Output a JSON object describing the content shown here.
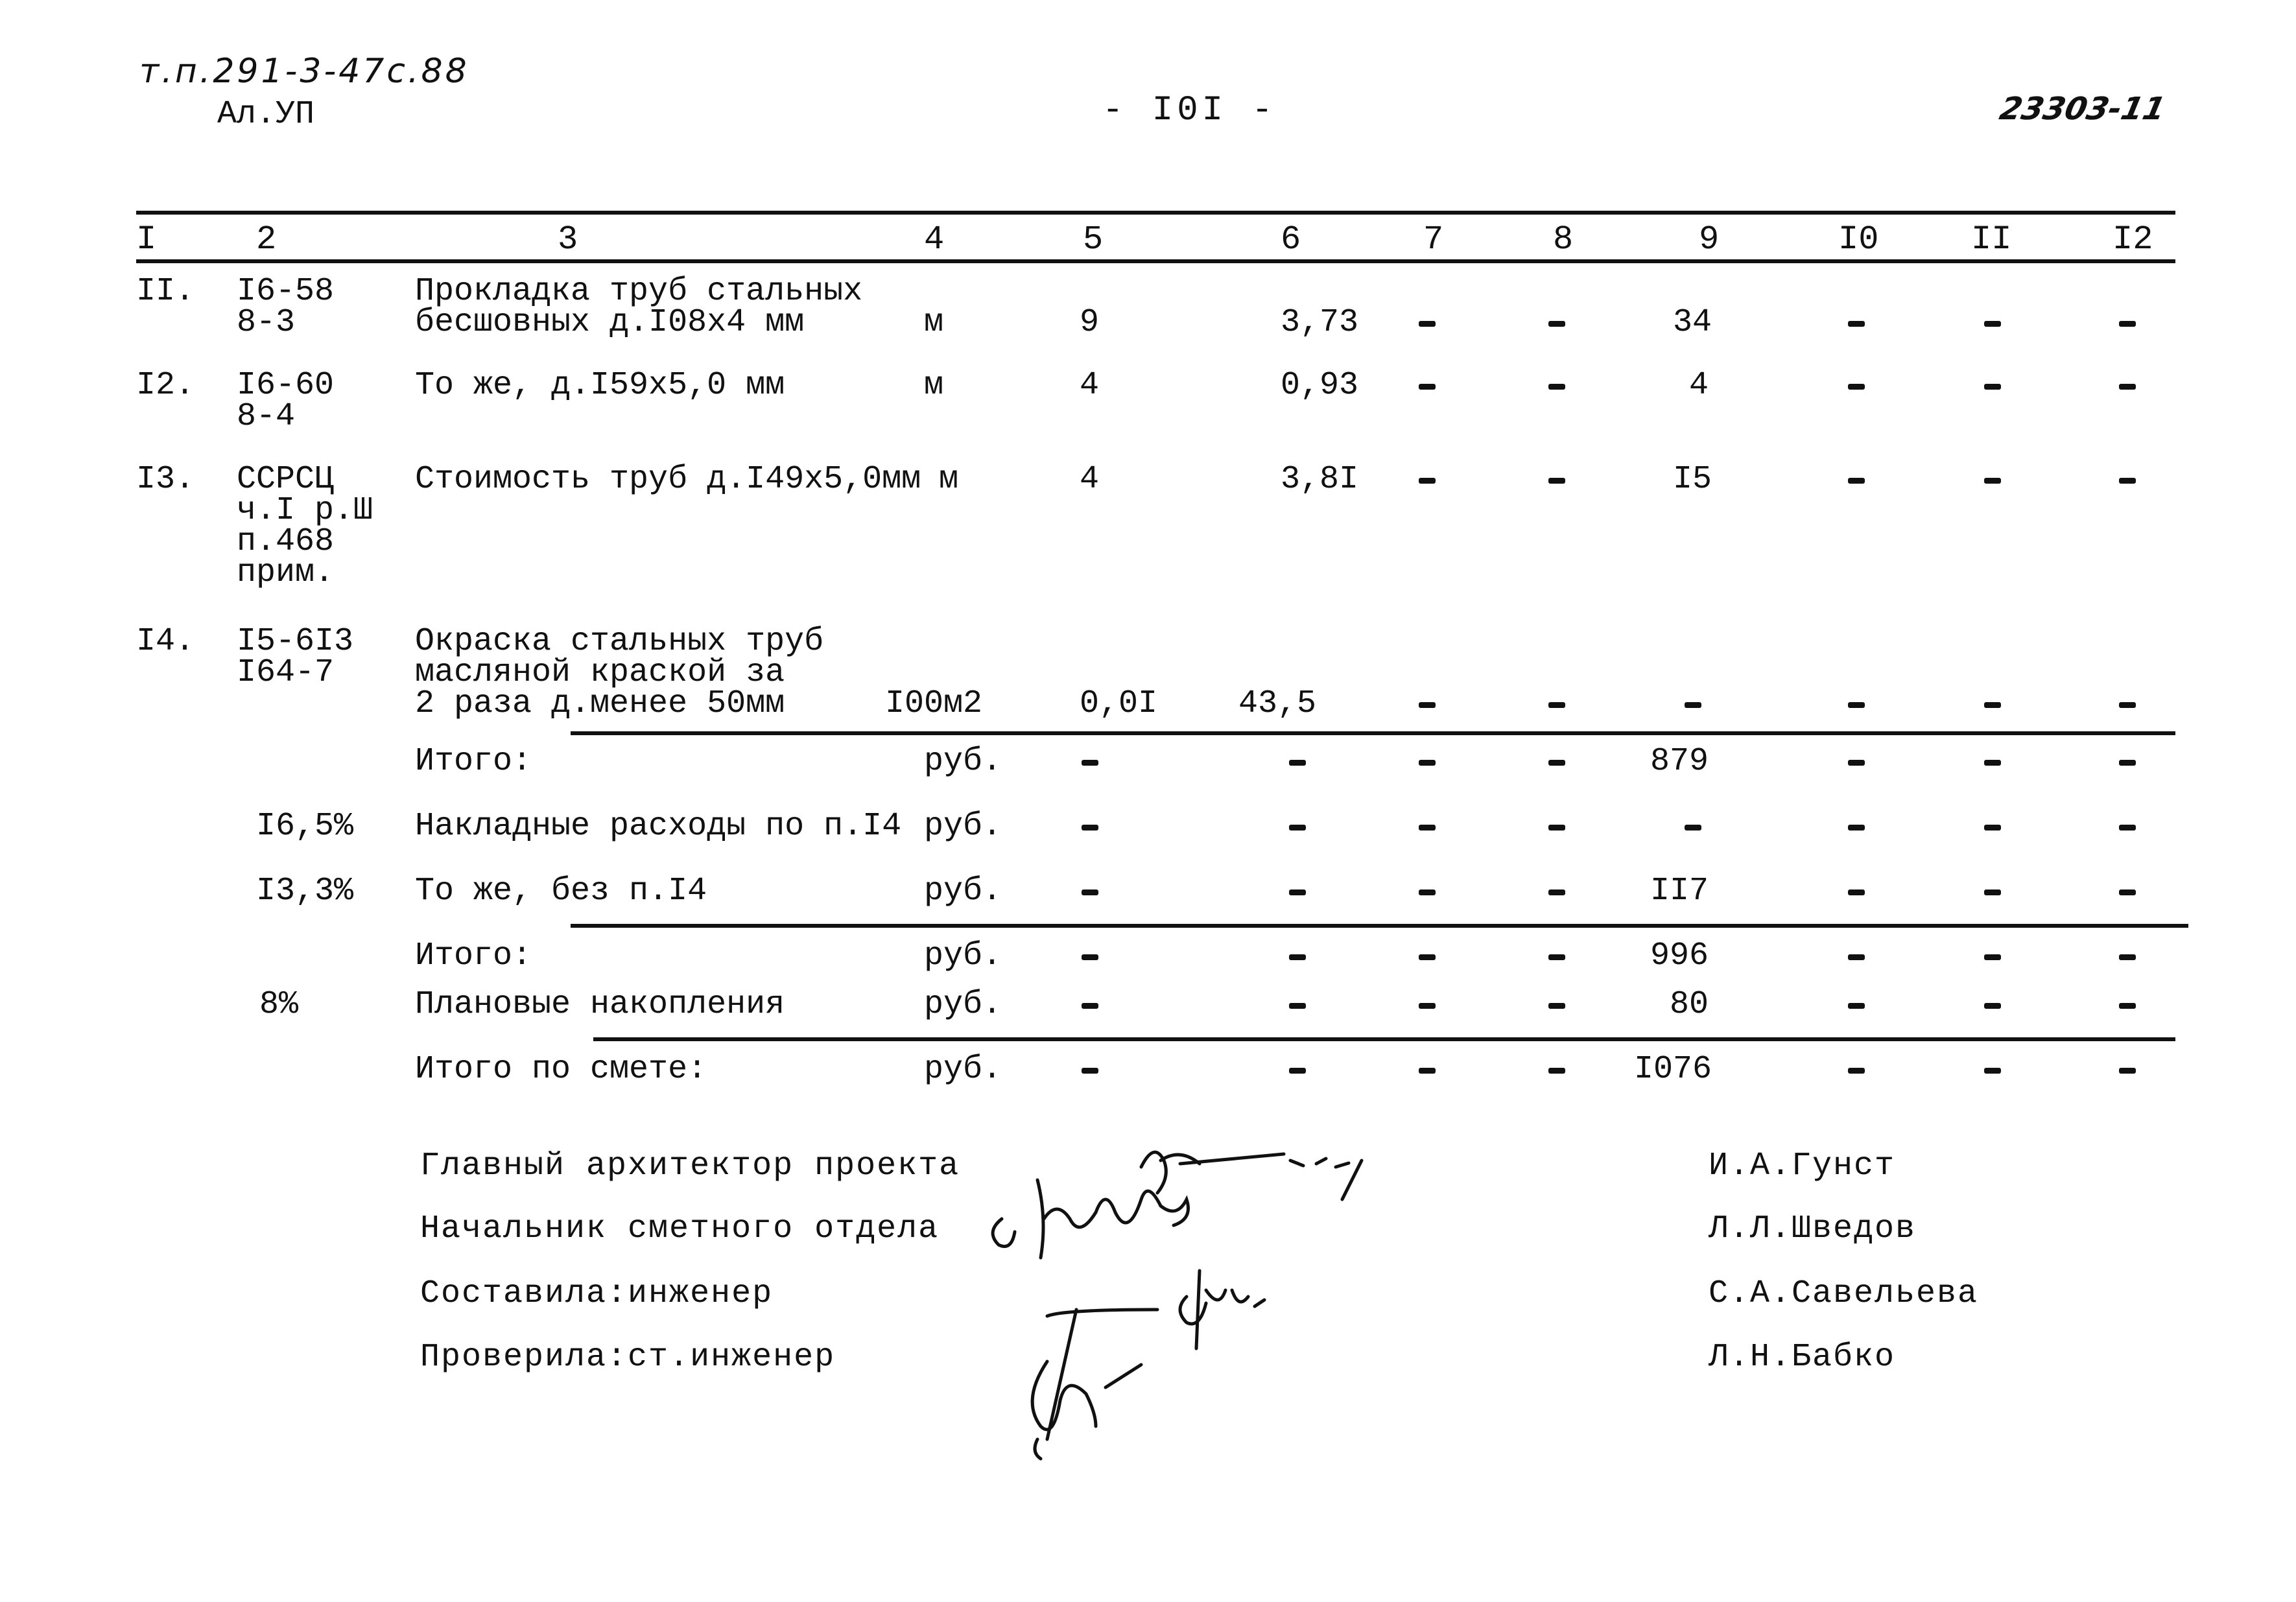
{
  "header": {
    "doc_code": "т.п.291-3-47с.88",
    "album": "Ал.УП",
    "page_number": "- I0I -",
    "inventory_number": "23303-11"
  },
  "table": {
    "column_headers": [
      "I",
      "2",
      "3",
      "4",
      "5",
      "6",
      "7",
      "8",
      "9",
      "I0",
      "II",
      "I2"
    ],
    "rows": [
      {
        "num": "II.",
        "code": [
          "I6-58",
          "8-3"
        ],
        "description": [
          "Прокладка труб стальных",
          "бесшовных д.I08х4 мм"
        ],
        "unit": "м",
        "qty": "9",
        "price": "3,73",
        "c7": "-",
        "c8": "-",
        "c9": "34",
        "c10": "-",
        "c11": "-",
        "c12": "-"
      },
      {
        "num": "I2.",
        "code": [
          "I6-60",
          "8-4"
        ],
        "description": [
          "То же, д.I59х5,0 мм"
        ],
        "unit": "м",
        "qty": "4",
        "price": "0,93",
        "c7": "-",
        "c8": "-",
        "c9": "4",
        "c10": "-",
        "c11": "-",
        "c12": "-"
      },
      {
        "num": "I3.",
        "code": [
          "ССРСЦ",
          "ч.I р.Ш",
          "п.468",
          "прим."
        ],
        "description": [
          "Стоимость труб д.I49х5,0мм"
        ],
        "unit": "м",
        "qty": "4",
        "price": "3,8I",
        "c7": "-",
        "c8": "-",
        "c9": "I5",
        "c10": "-",
        "c11": "-",
        "c12": "-"
      },
      {
        "num": "I4.",
        "code": [
          "I5-6I3",
          "I64-7"
        ],
        "description": [
          "Окраска стальных труб",
          "масляной краской за",
          "2 раза д.менее 50мм"
        ],
        "unit": "I00м2",
        "qty": "0,0I",
        "price": "43,5",
        "c7": "-",
        "c8": "-",
        "c9": "-",
        "c10": "-",
        "c11": "-",
        "c12": "-"
      }
    ],
    "summary_rows": [
      {
        "rate": "",
        "label": "Итого:",
        "unit": "руб.",
        "c5": "-",
        "c6": "-",
        "c7": "-",
        "c8": "-",
        "c9": "879",
        "c10": "-",
        "c11": "-",
        "c12": "-"
      },
      {
        "rate": "I6,5%",
        "label": "Накладные расходы по п.I4",
        "unit": "руб.",
        "c5": "-",
        "c6": "-",
        "c7": "-",
        "c8": "-",
        "c9": "-",
        "c10": "-",
        "c11": "-",
        "c12": "-"
      },
      {
        "rate": "I3,3%",
        "label": "То же, без п.I4",
        "unit": "руб.",
        "c5": "-",
        "c6": "-",
        "c7": "-",
        "c8": "-",
        "c9": "II7",
        "c10": "-",
        "c11": "-",
        "c12": "-"
      },
      {
        "rate": "",
        "label": "Итого:",
        "unit": "руб.",
        "c5": "-",
        "c6": "-",
        "c7": "-",
        "c8": "-",
        "c9": "996",
        "c10": "-",
        "c11": "-",
        "c12": "-"
      },
      {
        "rate": "8%",
        "label": "Плановые накопления",
        "unit": "руб.",
        "c5": "-",
        "c6": "-",
        "c7": "-",
        "c8": "-",
        "c9": "80",
        "c10": "-",
        "c11": "-",
        "c12": "-"
      },
      {
        "rate": "",
        "label": "Итого по смете:",
        "unit": "руб.",
        "c5": "-",
        "c6": "-",
        "c7": "-",
        "c8": "-",
        "c9": "I076",
        "c10": "-",
        "c11": "-",
        "c12": "-"
      }
    ]
  },
  "signatures": [
    {
      "role": "Главный архитектор проекта",
      "name": "И.А.Гунст"
    },
    {
      "role": "Начальник сметного отдела",
      "name": "Л.Л.Шведов"
    },
    {
      "role": "Составила:инженер",
      "name": "С.А.Савельева"
    },
    {
      "role": "Проверила:ст.инженер",
      "name": "Л.Н.Бабко"
    }
  ]
}
